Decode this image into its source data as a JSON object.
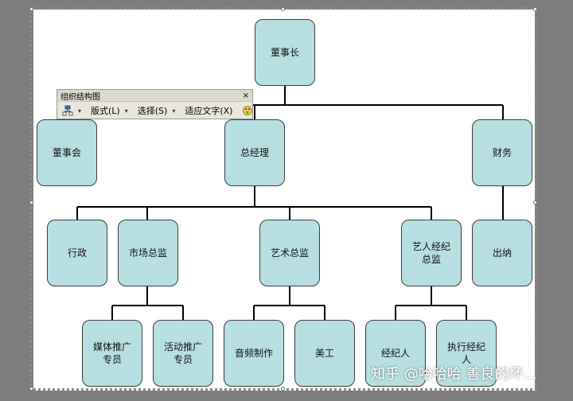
{
  "chart": {
    "nodes": {
      "chairman": "董事长",
      "board": "董事会",
      "gm": "总经理",
      "finance": "财务",
      "admin": "行政",
      "market_director": "市场总监",
      "art_director": "艺术总监",
      "artist_director": "艺人经纪\n总监",
      "cashier": "出纳",
      "media_promo": "媒体推广\n专员",
      "event_promo": "活动推广\n专员",
      "audio": "音频制作",
      "design": "美工",
      "agent": "经纪人",
      "exec_agent": "执行经纪\n人"
    }
  },
  "toolbar": {
    "title": "组织结构图",
    "close": "×",
    "layout_label": "版式(L)",
    "select_label": "选择(S)",
    "fit_text_label": "适应文字(X)"
  },
  "watermark": "知乎 @哈哈哈 善良的坏..."
}
